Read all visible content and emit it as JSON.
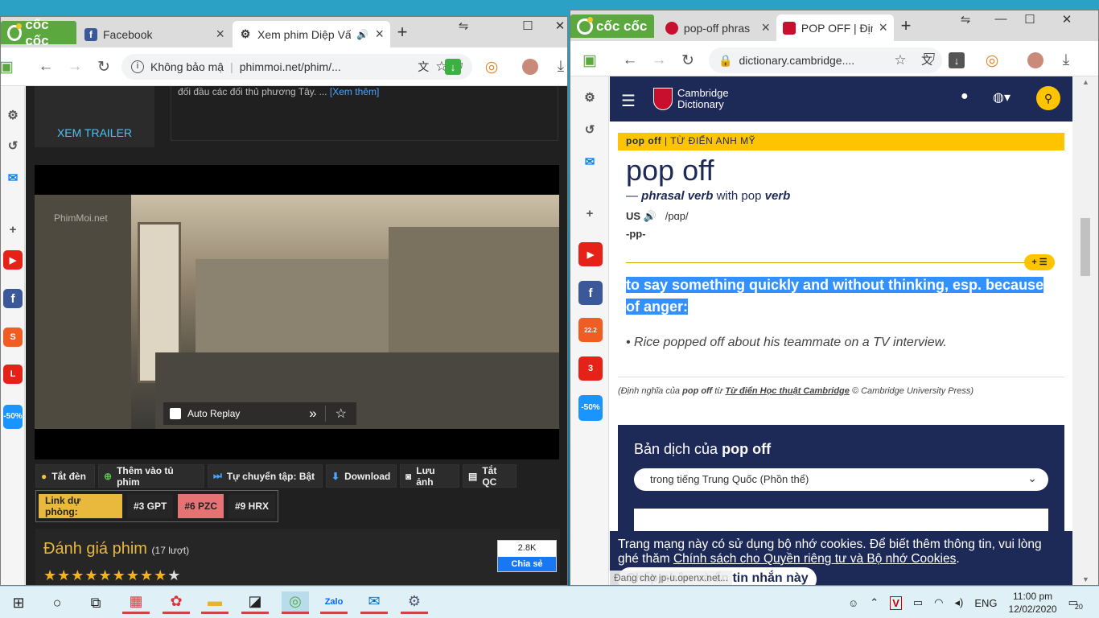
{
  "left_window": {
    "brand": "cốc cốc",
    "tabs": [
      {
        "label": "Facebook",
        "icon": "facebook-icon"
      },
      {
        "label": "Xem phim Diệp Vấ",
        "icon": "gear-icon"
      }
    ],
    "address": {
      "security": "Không bảo mậ",
      "url": "phimmoi.net/phim/..."
    },
    "page": {
      "desc_text": "đối đầu các đối thủ phương Tây. ...",
      "read_more": "[Xem thêm]",
      "trailer": "XEM TRAILER",
      "watermark": "PhimMoi.net",
      "auto_replay": "Auto Replay",
      "buttons": [
        "Tắt đèn",
        "Thêm vào tủ phim",
        "Tự chuyển tập: Bật",
        "Download",
        "Lưu ảnh",
        "Tắt QC"
      ],
      "backup_label": "Link dự phòng:",
      "backups": [
        "#3 GPT",
        "#6 PZC",
        "#9 HRX"
      ],
      "rating_title": "Đánh giá phim",
      "rating_count": "(17 lượt)",
      "stars_filled": 9,
      "stars_total": 10,
      "share_count": "2.8K",
      "share_label": "Chia sẻ"
    }
  },
  "right_window": {
    "brand": "cốc cốc",
    "tabs": [
      {
        "label": "pop-off phras",
        "icon": "globe-icon"
      },
      {
        "label": "POP OFF | Địn",
        "icon": "cambridge-icon"
      }
    ],
    "address": {
      "url": "dictionary.cambridge...."
    },
    "site": {
      "logo_line1": "Cambridge",
      "logo_line2": "Dictionary",
      "entry_word": "pop off",
      "entry_tag": "| TỪ ĐIỂN ANH MỸ",
      "headword": "pop off",
      "pos_prefix": "—",
      "pos": "phrasal verb",
      "pos_with": "with pop",
      "pos_verb": "verb",
      "region": "US",
      "ipa": "/pɑp/",
      "grammar": "-pp-",
      "definition": "to say something quickly and without thinking, esp. because of anger:",
      "example": "Rice popped off about his teammate on a TV interview.",
      "credit_prefix": "(Định nghĩa của",
      "credit_word": "pop off",
      "credit_from": "từ",
      "credit_source": "Từ điển Học thuật Cambridge",
      "credit_suffix": "© Cambridge University Press)",
      "trans_title_prefix": "Bản dịch của",
      "trans_title_word": "pop off",
      "trans_lang": "trong tiếng Trung Quốc (Phồn thể)",
      "cookie_text": "Trang mạng này có sử dụng bộ nhớ cookies. Để biết thêm thông tin, vui lòng ghé thăm",
      "cookie_link": "Chính sách cho Quyền riêng tư và Bộ nhớ Cookies",
      "cookie_accept": "Chấp nhận và ẩn tin nhắn này",
      "status": "Đang chờ jp-u.openx.net..."
    }
  },
  "sidebar_badges": {
    "shopee": "22.2",
    "lazada_count": "3",
    "tiki": "-50%"
  },
  "taskbar": {
    "lang": "ENG",
    "time": "11:00 pm",
    "date": "12/02/2020",
    "notifications": "20"
  }
}
